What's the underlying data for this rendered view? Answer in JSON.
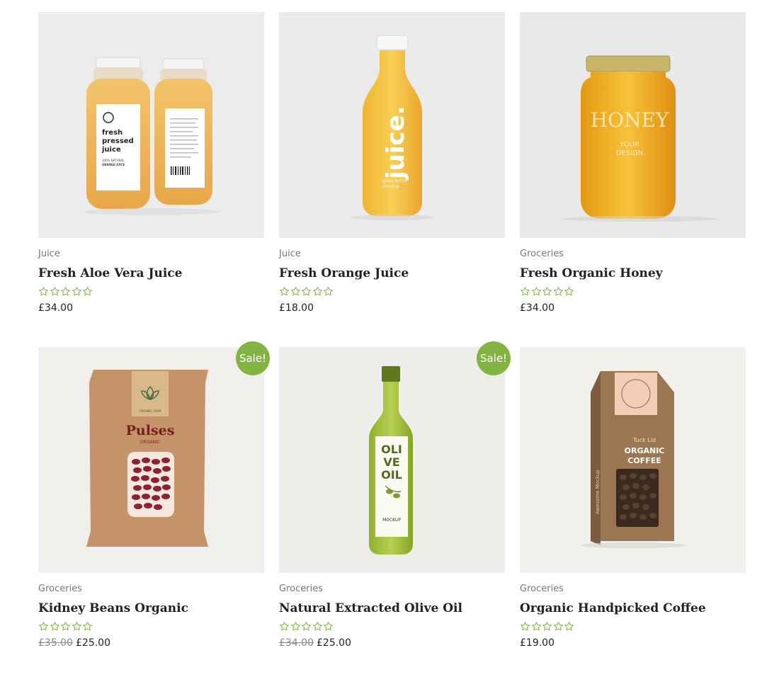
{
  "colors": {
    "accent": "#81b441",
    "rating_star": "#81b441",
    "text": "#222222",
    "muted": "#777777"
  },
  "products": [
    {
      "category": "Juice",
      "title": "Fresh Aloe Vera Juice",
      "rating": 0,
      "price": "£34.00",
      "sale": false,
      "image_text": {
        "label1": "fresh",
        "label2": "pressed",
        "label3": "juice",
        "small": "100% NATURAL",
        "small2": "ORANGE JUICE"
      }
    },
    {
      "category": "Juice",
      "title": "Fresh Orange Juice",
      "rating": 0,
      "price": "£18.00",
      "sale": false,
      "image_text": {
        "label1": "juice.",
        "small": "glass bottle",
        "small2": "mockup"
      }
    },
    {
      "category": "Groceries",
      "title": "Fresh Organic Honey",
      "rating": 0,
      "price": "£34.00",
      "sale": false,
      "image_text": {
        "label1": "HONEY",
        "small": "YOUR",
        "small2": "DESIGN"
      }
    },
    {
      "category": "Groceries",
      "title": "Kidney Beans Organic",
      "rating": 0,
      "old_price": "£35.00",
      "price": "£25.00",
      "sale": true,
      "sale_label": "Sale!",
      "image_text": {
        "label1": "Pulses",
        "small": "ORGANIC",
        "small2": "ORGANIC FARM"
      }
    },
    {
      "category": "Groceries",
      "title": "Natural Extracted Olive Oil",
      "rating": 0,
      "old_price": "£34.00",
      "price": "£25.00",
      "sale": true,
      "sale_label": "Sale!",
      "image_text": {
        "label1": "OLI",
        "label2": "VE",
        "label3": "OIL",
        "small": "MOCKUP"
      }
    },
    {
      "category": "Groceries",
      "title": "Organic Handpicked Coffee",
      "rating": 0,
      "price": "£19.00",
      "sale": false,
      "image_text": {
        "label1": "Tuck Lid",
        "label2": "ORGANIC",
        "label3": "COFFEE",
        "small": "Awesome Mockup"
      }
    }
  ]
}
